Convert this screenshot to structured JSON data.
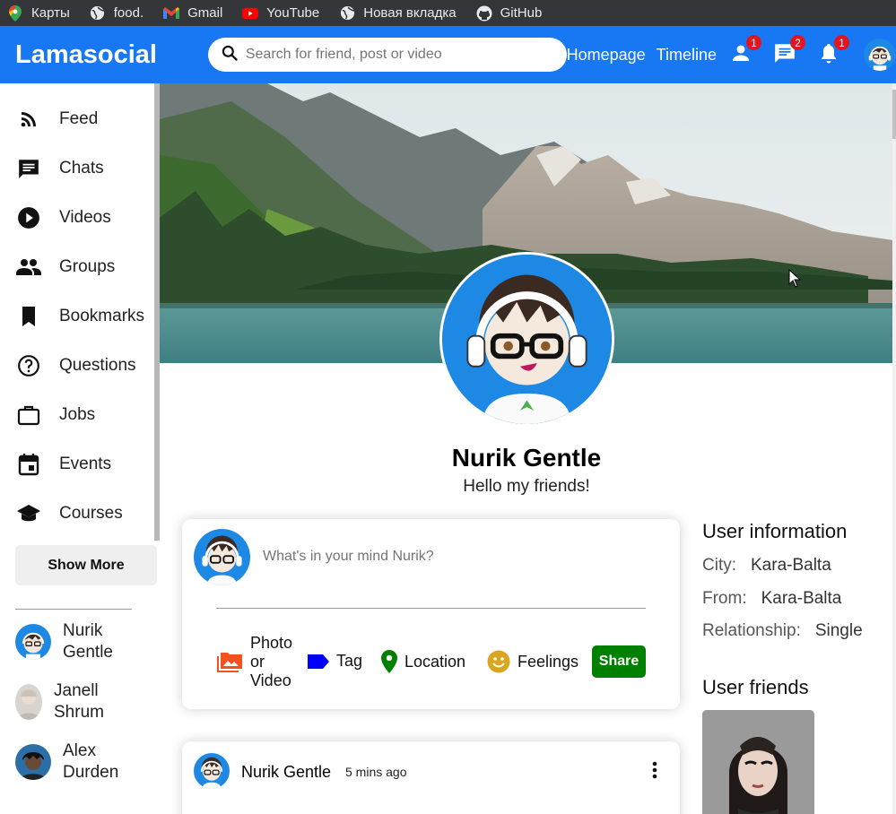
{
  "bookmarks": [
    {
      "label": "Карты",
      "icon": "maps-icon"
    },
    {
      "label": "food.",
      "icon": "globe-icon"
    },
    {
      "label": "Gmail",
      "icon": "gmail-icon"
    },
    {
      "label": "YouTube",
      "icon": "youtube-icon"
    },
    {
      "label": "Новая вкладка",
      "icon": "globe-icon"
    },
    {
      "label": "GitHub",
      "icon": "github-icon"
    }
  ],
  "topbar": {
    "logo": "Lamasocial",
    "search_placeholder": "Search for friend, post or video",
    "links": [
      "Homepage",
      "Timeline"
    ],
    "badges": {
      "person": "1",
      "chat": "2",
      "notifications": "1"
    },
    "colors": {
      "bar": "#1877f2",
      "badge": "#e0161e"
    }
  },
  "sidebar": {
    "items": [
      {
        "label": "Feed",
        "icon": "rss-feed-icon"
      },
      {
        "label": "Chats",
        "icon": "chat-icon"
      },
      {
        "label": "Videos",
        "icon": "play-circle-icon"
      },
      {
        "label": "Groups",
        "icon": "group-icon"
      },
      {
        "label": "Bookmarks",
        "icon": "bookmark-icon"
      },
      {
        "label": "Questions",
        "icon": "help-outline-icon"
      },
      {
        "label": "Jobs",
        "icon": "work-outline-icon"
      },
      {
        "label": "Events",
        "icon": "event-icon"
      },
      {
        "label": "Courses",
        "icon": "school-icon"
      }
    ],
    "show_more": "Show More",
    "friends": [
      {
        "name": "Nurik Gentle"
      },
      {
        "name": "Janell Shrum"
      },
      {
        "name": "Alex Durden"
      }
    ]
  },
  "profile": {
    "name": "Nurik Gentle",
    "description": "Hello my friends!"
  },
  "share": {
    "placeholder": "What's in your mind Nurik?",
    "options": {
      "photo": "Photo or Video",
      "tag": "Tag",
      "location": "Location",
      "feelings": "Feelings"
    },
    "button": "Share",
    "colors": {
      "photo": "#f4511e",
      "tag": "#0000ff",
      "location": "#008000",
      "feelings": "#daa520",
      "button": "#008000"
    }
  },
  "post": {
    "username": "Nurik Gentle",
    "time": "5 mins ago"
  },
  "rightbar": {
    "info_title": "User information",
    "info": [
      {
        "key": "City:",
        "value": "Kara-Balta"
      },
      {
        "key": "From:",
        "value": "Kara-Balta"
      },
      {
        "key": "Relationship:",
        "value": "Single"
      }
    ],
    "friends_title": "User friends"
  }
}
